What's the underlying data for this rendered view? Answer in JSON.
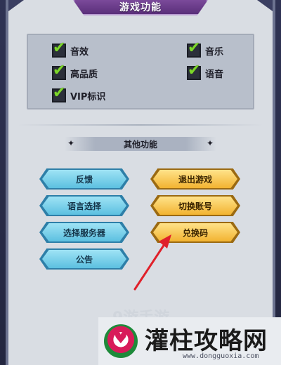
{
  "title": "游戏功能",
  "settings": {
    "options": [
      {
        "label": "音效",
        "checked": true
      },
      {
        "label": "音乐",
        "checked": true
      },
      {
        "label": "高品质",
        "checked": true
      },
      {
        "label": "语音",
        "checked": true
      },
      {
        "label": "VIP标识",
        "checked": true
      }
    ],
    "check_glyph": "✔"
  },
  "other": {
    "header": "其他功能",
    "buttons": {
      "feedback": "反馈",
      "exit_game": "退出游戏",
      "language": "语言选择",
      "switch_account": "切换账号",
      "select_server": "选择服务器",
      "redeem_code": "兑换码",
      "notice": "公告"
    }
  },
  "watermark": {
    "text": "9游手游",
    "brand": "灌柱攻略网",
    "url": "www.dongguoxia.com"
  },
  "colors": {
    "accent_arrow": "#e0202a",
    "blue_button": "#5cc0e0",
    "gold_button": "#f2b331",
    "check_green": "#7cd62a"
  }
}
